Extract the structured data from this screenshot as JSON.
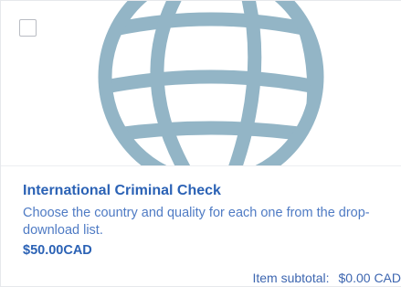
{
  "product": {
    "image_icon": "globe-icon",
    "title": "International Criminal Check",
    "description": "Choose the country and quality for each one from the drop-download list.",
    "price": "$50.00",
    "currency": "CAD"
  },
  "subtotal": {
    "label": "Item subtotal:",
    "value": "$0.00 CAD"
  },
  "colors": {
    "globe": "#93b5c6",
    "title": "#2b62b5",
    "description": "#4f7bc4",
    "checkbox_border": "#b9bcc3"
  }
}
